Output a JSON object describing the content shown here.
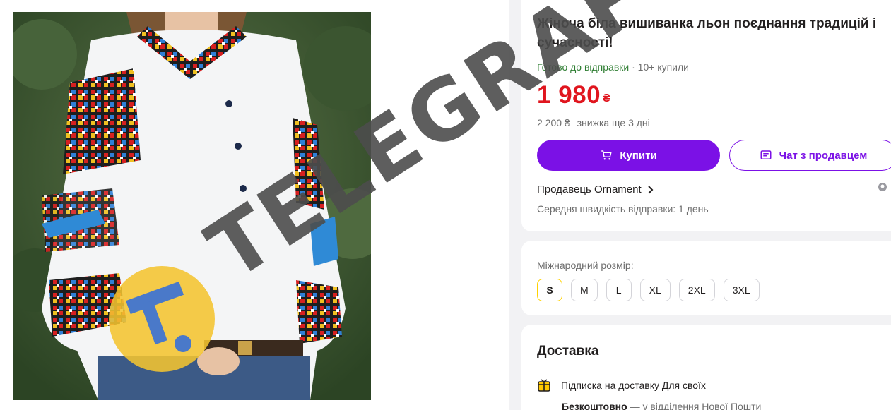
{
  "product": {
    "title": "Жіноча біла вишиванка льон поєднання традицій і сучасності!",
    "ready_status": "Готово до відправки",
    "bought_count": "10+ купили",
    "price": "1 980",
    "currency": "₴",
    "old_price": "2 200 ₴",
    "discount_note": "знижка ще 3 дні"
  },
  "actions": {
    "buy_label": "Купити",
    "chat_label": "Чат з продавцем"
  },
  "seller": {
    "label": "Продавець Ornament",
    "speed": "Середня швидкість відправки: 1 день"
  },
  "size": {
    "label": "Міжнародний розмір:",
    "options": [
      "S",
      "M",
      "L",
      "XL",
      "2XL",
      "3XL"
    ],
    "selected": "S"
  },
  "delivery": {
    "title": "Доставка",
    "subscription": "Підписка на доставку Для своїх",
    "free": "Безкоштовно",
    "free_note": " — у відділення Нової Пошти"
  },
  "watermark": {
    "text": "TELEGRAF"
  },
  "colors": {
    "accent": "#7b11e6",
    "price": "#e0151e",
    "ready": "#2e7d32",
    "selected_size": "#ffd200"
  }
}
